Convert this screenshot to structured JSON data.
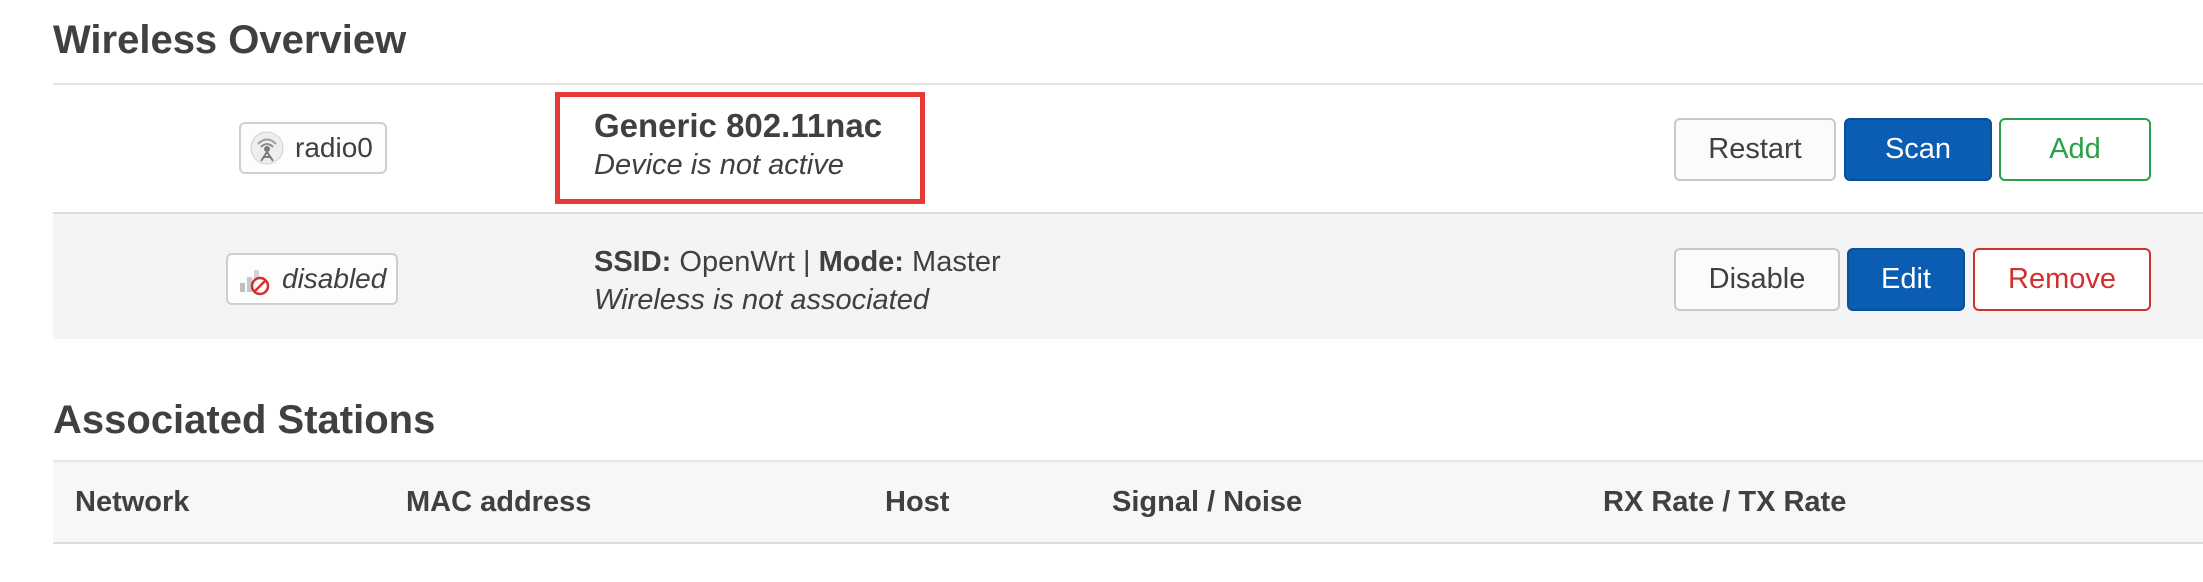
{
  "wireless_overview": {
    "title": "Wireless Overview",
    "device": {
      "badge_label": "radio0",
      "icon": "wifi-radio-icon",
      "name": "Generic 802.11nac",
      "status": "Device is not active",
      "buttons": {
        "restart": "Restart",
        "scan": "Scan",
        "add": "Add"
      }
    },
    "interface": {
      "badge_label": "disabled",
      "icon": "wifi-disabled-icon",
      "ssid_label": "SSID:",
      "ssid_value": "OpenWrt",
      "separator": "|",
      "mode_label": "Mode:",
      "mode_value": "Master",
      "status": "Wireless is not associated",
      "buttons": {
        "disable": "Disable",
        "edit": "Edit",
        "remove": "Remove"
      }
    }
  },
  "associated_stations": {
    "title": "Associated Stations",
    "columns": [
      "Network",
      "MAC address",
      "Host",
      "Signal / Noise",
      "RX Rate / TX Rate"
    ]
  },
  "colors": {
    "primary": "#0b5cb3",
    "add": "#2aa148",
    "remove": "#d32f2f",
    "highlight": "#e53935"
  }
}
